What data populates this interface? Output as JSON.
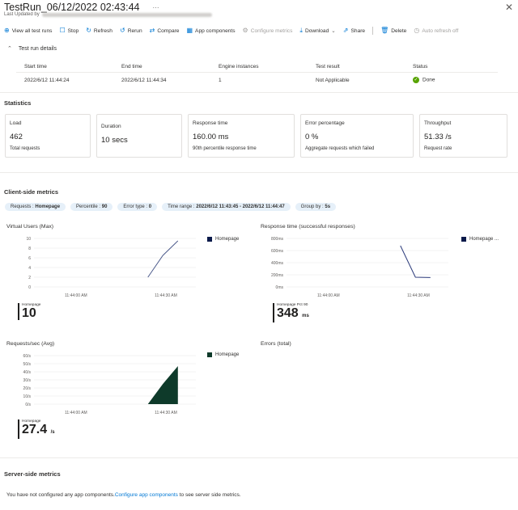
{
  "header": {
    "title": "TestRun_06/12/2022 02:43:44",
    "ellipsis": "···",
    "close": "✕",
    "last_updated_label": "Last Updated by"
  },
  "toolbar": [
    {
      "label": "View all test runs",
      "icon": "plus-icon",
      "glyph": "⊕",
      "disabled": false
    },
    {
      "label": "Stop",
      "icon": "stop-icon",
      "glyph": "☐",
      "disabled": false
    },
    {
      "label": "Refresh",
      "icon": "refresh-icon",
      "glyph": "↻",
      "disabled": false
    },
    {
      "label": "Rerun",
      "icon": "rerun-icon",
      "glyph": "↺",
      "disabled": false
    },
    {
      "label": "Compare",
      "icon": "compare-icon",
      "glyph": "⇄",
      "disabled": false
    },
    {
      "label": "App components",
      "icon": "app-components-icon",
      "glyph": "▦",
      "disabled": false
    },
    {
      "label": "Configure metrics",
      "icon": "gear-icon",
      "glyph": "⚙",
      "disabled": true
    },
    {
      "label": "Download",
      "icon": "download-icon",
      "glyph": "⤓",
      "disabled": false,
      "chevron": "⌄"
    },
    {
      "label": "Share",
      "icon": "share-icon",
      "glyph": "⇗",
      "disabled": false
    },
    {
      "label": "Delete",
      "icon": "delete-icon",
      "glyph": "🗑",
      "disabled": false
    },
    {
      "label": "Auto refresh off",
      "icon": "clock-icon",
      "glyph": "◷",
      "disabled": true
    }
  ],
  "details": {
    "toggle_label": "Test run details",
    "chevron": "⌃",
    "headers": [
      "Start time",
      "End time",
      "Engine instances",
      "Test result",
      "Status"
    ],
    "row": [
      "2022/6/12 11:44:24",
      "2022/6/12 11:44:34",
      "1",
      "Not Applicable",
      "Done"
    ],
    "done_check": "✓"
  },
  "statistics": {
    "title": "Statistics",
    "cards": [
      {
        "label": "Load",
        "value": "462",
        "sub": "Total requests"
      },
      {
        "label": "Duration",
        "value": "10 secs",
        "sub": ""
      },
      {
        "label": "Response time",
        "value": "160.00 ms",
        "sub": "90th percentile response time"
      },
      {
        "label": "Error percentage",
        "value": "0 %",
        "sub": "Aggregate requests which failed"
      },
      {
        "label": "Throughput",
        "value": "51.33 /s",
        "sub": "Request rate"
      }
    ]
  },
  "client_metrics": {
    "title": "Client-side metrics",
    "filters": [
      {
        "label": "Requests : ",
        "value": "Homepage"
      },
      {
        "label": "Percentile : ",
        "value": "90"
      },
      {
        "label": "Error type : ",
        "value": "0"
      },
      {
        "label": "Time range : ",
        "value": "2022/6/12 11:43:45 - 2022/6/12 11:44:47"
      },
      {
        "label": "Group by : ",
        "value": "5s"
      }
    ]
  },
  "colors": {
    "vu_line": "#4d5b8c",
    "rt_line": "#2b3a7a",
    "rps_area": "#0e3a2a",
    "accent": "#0078d4"
  },
  "chart_data": [
    {
      "type": "line",
      "title": "Virtual Users (Max)",
      "x_ticks": [
        "11:44:00 AM",
        "11:44:30 AM"
      ],
      "y_ticks": [
        "10",
        "8",
        "6",
        "4",
        "2",
        "0"
      ],
      "ylim": [
        0,
        10
      ],
      "series": [
        {
          "name": "Homepage",
          "x_seconds": [
            24,
            29,
            34
          ],
          "values": [
            2,
            6.5,
            9.5
          ]
        }
      ],
      "summary_label": "Homepage",
      "summary_value": "10",
      "summary_unit": ""
    },
    {
      "type": "line",
      "title": "Response time (successful responses)",
      "x_ticks": [
        "11:44:00 AM",
        "11:44:30 AM"
      ],
      "y_ticks": [
        "800ms",
        "600ms",
        "400ms",
        "200ms",
        "0ms"
      ],
      "ylim": [
        0,
        800
      ],
      "series": [
        {
          "name": "Homepage ...",
          "x_seconds": [
            24,
            29,
            34
          ],
          "values": [
            680,
            160,
            155
          ]
        }
      ],
      "summary_label": "Homepage Pct 90",
      "summary_value": "348",
      "summary_unit": "ms"
    },
    {
      "type": "area",
      "title": "Requests/sec (Avg)",
      "x_ticks": [
        "11:44:00 AM",
        "11:44:30 AM"
      ],
      "y_ticks": [
        "60/s",
        "50/s",
        "40/s",
        "30/s",
        "20/s",
        "10/s",
        "0/s"
      ],
      "ylim": [
        0,
        60
      ],
      "series": [
        {
          "name": "Homepage",
          "x_seconds": [
            24,
            29,
            34
          ],
          "values": [
            0,
            25,
            47
          ]
        }
      ],
      "summary_label": "Homepage",
      "summary_value": "27.4",
      "summary_unit": "/s"
    },
    {
      "type": "line",
      "title": "Errors (total)",
      "series": []
    }
  ],
  "server_metrics": {
    "title": "Server-side metrics",
    "message": "You have not configured any app components.",
    "link": "Configure app components",
    "message_suffix": " to see server side metrics."
  }
}
